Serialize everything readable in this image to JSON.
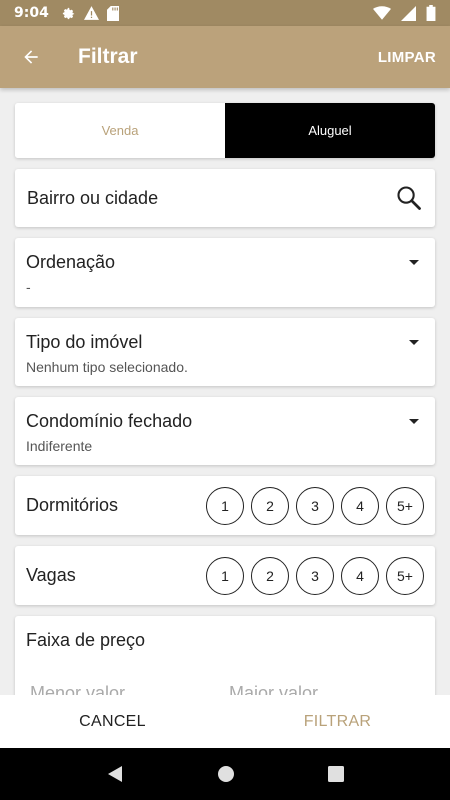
{
  "status_bar": {
    "time": "9:04"
  },
  "app_bar": {
    "title": "Filtrar",
    "clear_label": "LIMPAR"
  },
  "segment": {
    "sale_label": "Venda",
    "rent_label": "Aluguel",
    "selected": "Aluguel"
  },
  "search": {
    "placeholder": "Bairro ou cidade"
  },
  "ordering": {
    "label": "Ordenação",
    "value": "-"
  },
  "property_type": {
    "label": "Tipo do imóvel",
    "value": "Nenhum tipo selecionado."
  },
  "gated_community": {
    "label": "Condomínio fechado",
    "value": "Indiferente"
  },
  "bedrooms": {
    "label": "Dormitórios",
    "options": [
      "1",
      "2",
      "3",
      "4",
      "5+"
    ]
  },
  "parking": {
    "label": "Vagas",
    "options": [
      "1",
      "2",
      "3",
      "4",
      "5+"
    ]
  },
  "price_range": {
    "label": "Faixa de preço",
    "min_placeholder": "Menor valor",
    "max_placeholder": "Maior valor"
  },
  "actions": {
    "cancel_label": "CANCEL",
    "apply_label": "FILTRAR"
  },
  "colors": {
    "accent": "#bba27b",
    "accent_dark": "#a08a63",
    "selected_segment": "#000000"
  }
}
